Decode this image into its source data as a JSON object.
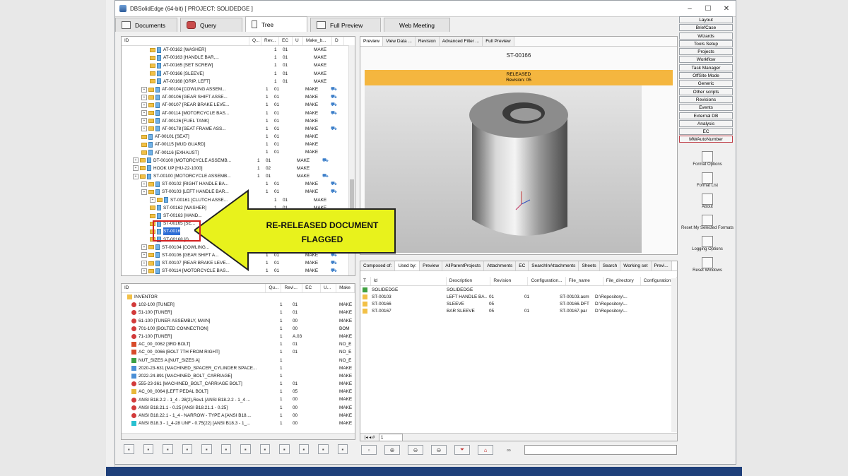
{
  "window": {
    "title": "DBSolidEdge (64-bit) [ PROJECT: SOLIDEDGE ]",
    "min": "–",
    "max": "☐",
    "close": "✕"
  },
  "tabs": [
    {
      "label": "Documents",
      "icon": "table-icon"
    },
    {
      "label": "Query",
      "icon": "database-icon"
    },
    {
      "label": "Tree",
      "icon": "tree-icon"
    },
    {
      "label": "Full Preview",
      "icon": "image-icon"
    },
    {
      "label": "Web Meeting",
      "icon": ""
    }
  ],
  "tree": {
    "headers": [
      "ID",
      "Q...",
      "Rev...",
      "EC",
      "U",
      "Make_b...",
      "D"
    ],
    "rows": [
      {
        "id": "AT-00162 [WASHER]",
        "q": "1",
        "rev": "01",
        "make": "MAKE",
        "d": "",
        "lvl": 3,
        "exp": false
      },
      {
        "id": "AT-00163 [HANDLE BAR,...",
        "q": "1",
        "rev": "01",
        "make": "MAKE",
        "d": "",
        "lvl": 3,
        "exp": false
      },
      {
        "id": "AT-00165 [SET SCREW]",
        "q": "1",
        "rev": "01",
        "make": "MAKE",
        "d": "",
        "lvl": 3,
        "exp": false
      },
      {
        "id": "AT-00166 [SLEEVE]",
        "q": "1",
        "rev": "01",
        "make": "MAKE",
        "d": "",
        "lvl": 3,
        "exp": false
      },
      {
        "id": "AT-00168 [GRIP, LEFT]",
        "q": "1",
        "rev": "01",
        "make": "MAKE",
        "d": "",
        "lvl": 3,
        "exp": false
      },
      {
        "id": "AT-00104 [COWLING ASSEM...",
        "q": "1",
        "rev": "01",
        "make": "MAKE",
        "d": "⛟",
        "lvl": 2,
        "exp": true
      },
      {
        "id": "AT-00106 [GEAR SHIFT ASSE...",
        "q": "1",
        "rev": "01",
        "make": "MAKE",
        "d": "⛟",
        "lvl": 2,
        "exp": true
      },
      {
        "id": "AT-00107 [REAR BRAKE LEVE...",
        "q": "1",
        "rev": "01",
        "make": "MAKE",
        "d": "⛟",
        "lvl": 2,
        "exp": true
      },
      {
        "id": "AT-00114 [MOTORCYCLE BAS...",
        "q": "1",
        "rev": "01",
        "make": "MAKE",
        "d": "⛟",
        "lvl": 2,
        "exp": true
      },
      {
        "id": "AT-00126 [FUEL TANK]",
        "q": "1",
        "rev": "01",
        "make": "MAKE",
        "d": "",
        "lvl": 2,
        "exp": true
      },
      {
        "id": "AT-00178 [SEAT FRAME ASS...",
        "q": "1",
        "rev": "01",
        "make": "MAKE",
        "d": "⛟",
        "lvl": 2,
        "exp": true
      },
      {
        "id": "AT-00101 [SEAT]",
        "q": "1",
        "rev": "01",
        "make": "MAKE",
        "d": "",
        "lvl": 2,
        "exp": false
      },
      {
        "id": "AT-00115 [MUD GUARD]",
        "q": "1",
        "rev": "01",
        "make": "MAKE",
        "d": "",
        "lvl": 2,
        "exp": false
      },
      {
        "id": "AT-00116 [EXHAUST]",
        "q": "1",
        "rev": "01",
        "make": "MAKE",
        "d": "",
        "lvl": 2,
        "exp": false
      },
      {
        "id": "DT-00100 [MOTORCYCLE ASSEMB...",
        "q": "1",
        "rev": "01",
        "make": "MAKE",
        "d": "⛟",
        "lvl": 1,
        "exp": true
      },
      {
        "id": "HOOK UP [HU-22-1000]",
        "q": "1",
        "rev": "02",
        "make": "MAKE",
        "d": "",
        "lvl": 1,
        "exp": true
      },
      {
        "id": "ST-00100 [MOTORCYCLE ASSEMB...",
        "q": "1",
        "rev": "01",
        "make": "MAKE",
        "d": "⛟",
        "lvl": 1,
        "exp": true
      },
      {
        "id": "ST-00102 [RIGHT HANDLE BA...",
        "q": "1",
        "rev": "01",
        "make": "MAKE",
        "d": "⛟",
        "lvl": 2,
        "exp": true
      },
      {
        "id": "ST-00103 [LEFT HANDLE BAR...",
        "q": "1",
        "rev": "01",
        "make": "MAKE",
        "d": "⛟",
        "lvl": 2,
        "exp": true
      },
      {
        "id": "ST-00161 [CLUTCH ASSE...",
        "q": "1",
        "rev": "01",
        "make": "MAKE",
        "d": "",
        "lvl": 3,
        "exp": true
      },
      {
        "id": "ST-00162 [WASHER]",
        "q": "1",
        "rev": "01",
        "make": "MAKE",
        "d": "",
        "lvl": 3,
        "exp": false
      },
      {
        "id": "ST-00163 [HAND...",
        "q": "1",
        "rev": "01",
        "make": "",
        "d": "",
        "lvl": 3,
        "exp": false
      },
      {
        "id": "ST-00165 [SE...",
        "q": "1",
        "rev": "01",
        "make": "",
        "d": "",
        "lvl": 3,
        "exp": false
      },
      {
        "id": "ST-0016",
        "q": "1",
        "rev": "01",
        "make": "",
        "d": "",
        "lvl": 3,
        "exp": false,
        "sel": true
      },
      {
        "id": "ST-00168 [G...",
        "q": "1",
        "rev": "01",
        "make": "",
        "d": "",
        "lvl": 3,
        "exp": false
      },
      {
        "id": "ST-00104 [COWLING...",
        "q": "1",
        "rev": "01",
        "make": "",
        "d": "",
        "lvl": 2,
        "exp": true
      },
      {
        "id": "ST-00106 [GEAR SHIFT A...",
        "q": "1",
        "rev": "01",
        "make": "MAKE",
        "d": "⛟",
        "lvl": 2,
        "exp": true
      },
      {
        "id": "ST-00107 [REAR BRAKE LEVE...",
        "q": "1",
        "rev": "01",
        "make": "MAKE",
        "d": "⛟",
        "lvl": 2,
        "exp": true
      },
      {
        "id": "ST-00114 [MOTORCYCLE BAS...",
        "q": "1",
        "rev": "01",
        "make": "MAKE",
        "d": "⛟",
        "lvl": 2,
        "exp": true
      }
    ]
  },
  "callout": {
    "line1": "RE-RELEASED DOCUMENT",
    "line2": "FLAGGED"
  },
  "bottom_tree": {
    "headers": [
      "ID",
      "Qu...",
      "Revi...",
      "EC",
      "U...",
      "Make"
    ],
    "rows": [
      {
        "id": "INVENTOR",
        "q": "",
        "rev": "",
        "make": "",
        "icon": "folder"
      },
      {
        "id": "102-100 [TUNER]",
        "q": "1",
        "rev": "01",
        "make": "MAKE",
        "icon": "blocked"
      },
      {
        "id": "51-100 [TUNER]",
        "q": "1",
        "rev": "01",
        "make": "MAKE",
        "icon": "blocked"
      },
      {
        "id": "61-100 [TUNER ASSEMBLY, MAIN]",
        "q": "1",
        "rev": "00",
        "make": "MAKE",
        "icon": "blocked"
      },
      {
        "id": "701-100 [BOLTED CONNECTION]",
        "q": "1",
        "rev": "00",
        "make": "BOM",
        "icon": "blocked"
      },
      {
        "id": "71-100 [TUNER]",
        "q": "1",
        "rev": "A.03",
        "make": "MAKE",
        "icon": "blocked"
      },
      {
        "id": "AC_00_0062 [3RD BOLT]",
        "q": "1",
        "rev": "01",
        "make": "NO_E",
        "icon": "red"
      },
      {
        "id": "AC_00_0066 [BOLT 7TH FROM RIGHT]",
        "q": "1",
        "rev": "01",
        "make": "NO_E",
        "icon": "red"
      },
      {
        "id": "NUT_SIZES A [NUT_SIZES A]",
        "q": "1",
        "rev": "",
        "make": "NO_E",
        "icon": "green"
      },
      {
        "id": "2020-23-631 [MACHINED_SPACER_CYLINDER SPACE...",
        "q": "1",
        "rev": "",
        "make": "MAKE",
        "icon": "blue"
      },
      {
        "id": "2022-24-891 [MACHINED_BOLT_CARRIAGE]",
        "q": "1",
        "rev": "",
        "make": "MAKE",
        "icon": "blue"
      },
      {
        "id": "555-23-361 [MACHINED_BOLT_CARRIAGE BOLT]",
        "q": "1",
        "rev": "01",
        "make": "MAKE",
        "icon": "blocked"
      },
      {
        "id": "AC_00_0064 [LEFT PEDAL BOLT]",
        "q": "1",
        "rev": "05",
        "make": "MAKE",
        "icon": "yellow"
      },
      {
        "id": "ANSI B18.2.2 - 1_4 - 28(2),Rev1 [ANSI B18.2.2 - 1_4 ...",
        "q": "1",
        "rev": "00",
        "make": "MAKE",
        "icon": "blocked"
      },
      {
        "id": "ANSI B18.21.1 - 0.25 [ANSI B18.21.1 - 0.25]",
        "q": "1",
        "rev": "00",
        "make": "MAKE",
        "icon": "blocked"
      },
      {
        "id": "ANSI B18.22.1 - 1_4 - NARROW - TYPE A [ANSI B18....",
        "q": "1",
        "rev": "00",
        "make": "MAKE",
        "icon": "blocked"
      },
      {
        "id": "ANSI B18.3 - 1_4-28 UNF - 0.75(22) [ANSI B18.3 - 1_...",
        "q": "1",
        "rev": "00",
        "make": "MAKE",
        "icon": "cyan"
      }
    ]
  },
  "preview": {
    "tabs": [
      "Preview",
      "View Data ...",
      "Revision",
      "Advanced Filter ...",
      "Full Preview"
    ],
    "doc_id": "ST-00166",
    "status": "RELEASED",
    "revision": "Revision: 05"
  },
  "usedby": {
    "tabs": [
      "Composed of:",
      "Used by:",
      "Preview",
      "AllParentProjects",
      "Attachments",
      "EC",
      "SearchInAttachments",
      "Sheets",
      "Search",
      "Working set",
      "Previ..."
    ],
    "headers": [
      "T",
      "Id",
      "Description",
      "Revision",
      "Configuration...",
      "File_name",
      "File_directory",
      "Configuration"
    ],
    "rows": [
      {
        "id": "SOLIDEDGE",
        "desc": "SOLIDEDGE",
        "rev": "",
        "conf": "",
        "file": "",
        "dir": ""
      },
      {
        "id": "ST-00103",
        "desc": "LEFT HANDLE BA...",
        "rev": "01",
        "conf": "01",
        "file": "ST-00103.asm",
        "dir": "D:\\Repository\\..."
      },
      {
        "id": "ST-00166",
        "desc": "SLEEVE",
        "rev": "05",
        "conf": "",
        "file": "ST-00166.DFT",
        "dir": "D:\\Repository\\..."
      },
      {
        "id": "ST-00167",
        "desc": "BAR SLEEVE",
        "rev": "05",
        "conf": "01",
        "file": "ST-00167.par",
        "dir": "D:\\Repository\\..."
      }
    ],
    "page": "1"
  },
  "sidebar": {
    "items": [
      "Layout",
      "BriefCase",
      "Wizards",
      "Tools Setup",
      "Projects",
      "Workflow",
      "Task Manager",
      "OffSite Mode",
      "Generic",
      "Other scripts",
      "Revisions",
      "Events",
      "External DB",
      "Analysis",
      "EC",
      "MWAutoNumber"
    ],
    "tools": [
      "Format Options",
      "Format List",
      "About",
      "Reset My Selected Formats",
      "Logging Options",
      "Reset Windows"
    ]
  }
}
